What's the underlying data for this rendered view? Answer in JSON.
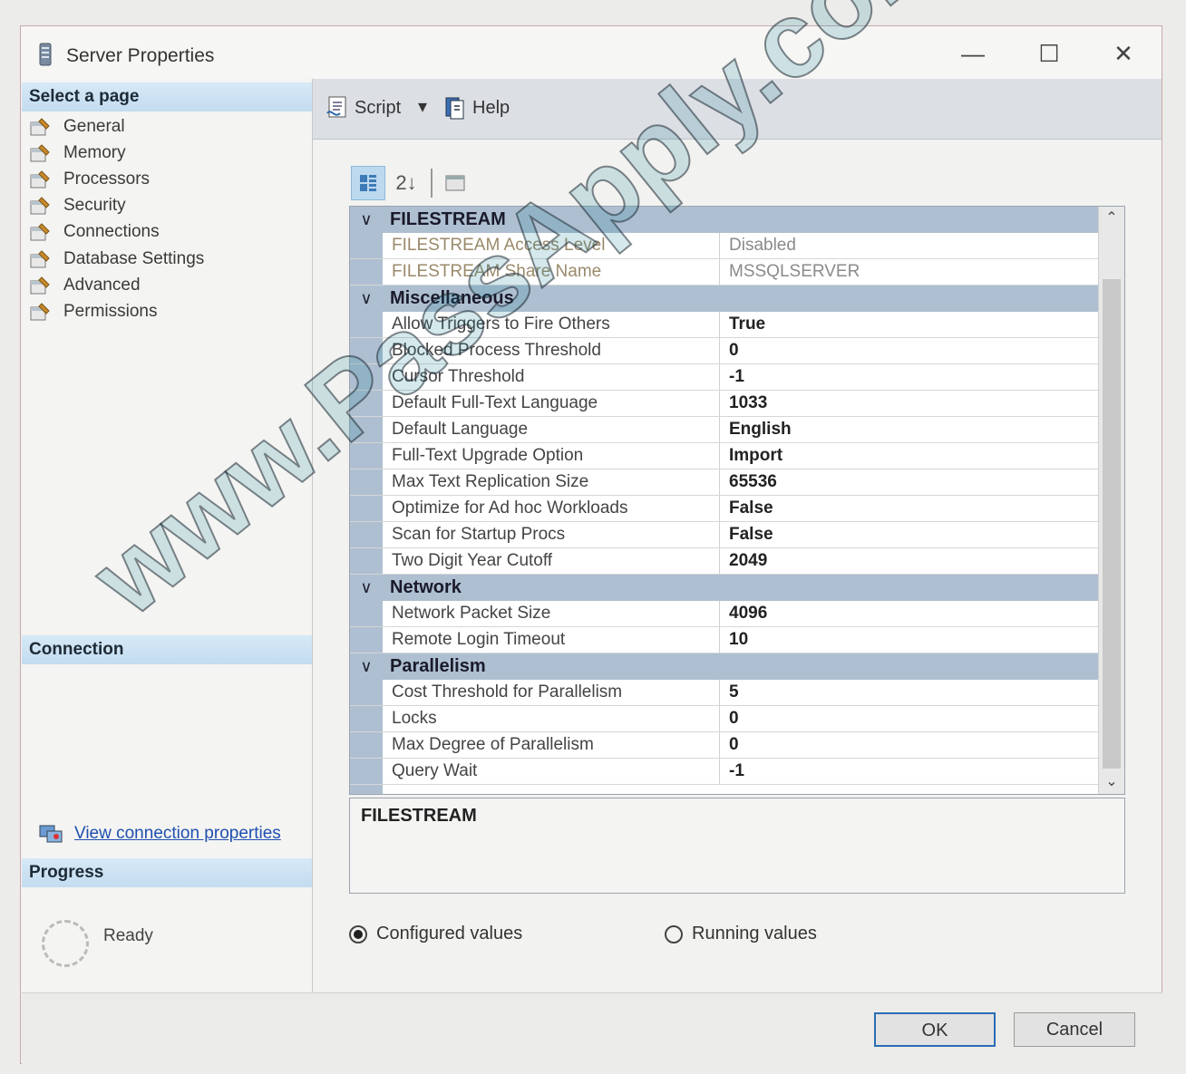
{
  "window": {
    "title": "Server Properties",
    "controls": {
      "minimize": "—",
      "maximize": "☐",
      "close": "✕"
    }
  },
  "left": {
    "select_page_header": "Select a page",
    "pages": [
      {
        "label": "General"
      },
      {
        "label": "Memory"
      },
      {
        "label": "Processors"
      },
      {
        "label": "Security"
      },
      {
        "label": "Connections"
      },
      {
        "label": "Database Settings"
      },
      {
        "label": "Advanced"
      },
      {
        "label": "Permissions"
      }
    ],
    "connection_header": "Connection",
    "view_connection_label": "View connection properties",
    "progress_header": "Progress",
    "progress_status": "Ready"
  },
  "toolbar": {
    "script_label": "Script",
    "script_dropdown": "▾",
    "help_label": "Help"
  },
  "grid_toolbar": {
    "sort_alpha_glyph": "2↓"
  },
  "grid": {
    "categories": [
      {
        "name": "FILESTREAM",
        "chevron": "∨",
        "rows": [
          {
            "name": "FILESTREAM Access Level",
            "value": "Disabled"
          },
          {
            "name": "FILESTREAM Share Name",
            "value": "MSSQLSERVER"
          }
        ]
      },
      {
        "name": "Miscellaneous",
        "chevron": "∨",
        "rows": [
          {
            "name": "Allow Triggers to Fire Others",
            "value": "True"
          },
          {
            "name": "Blocked Process Threshold",
            "value": "0"
          },
          {
            "name": "Cursor Threshold",
            "value": "-1"
          },
          {
            "name": "Default Full-Text Language",
            "value": "1033"
          },
          {
            "name": "Default Language",
            "value": "English"
          },
          {
            "name": "Full-Text Upgrade Option",
            "value": "Import"
          },
          {
            "name": "Max Text Replication Size",
            "value": "65536"
          },
          {
            "name": "Optimize for Ad hoc Workloads",
            "value": "False"
          },
          {
            "name": "Scan for Startup Procs",
            "value": "False"
          },
          {
            "name": "Two Digit Year Cutoff",
            "value": "2049"
          }
        ]
      },
      {
        "name": "Network",
        "chevron": "∨",
        "rows": [
          {
            "name": "Network Packet Size",
            "value": "4096"
          },
          {
            "name": "Remote Login Timeout",
            "value": "10"
          }
        ]
      },
      {
        "name": "Parallelism",
        "chevron": "∨",
        "rows": [
          {
            "name": "Cost Threshold for Parallelism",
            "value": "5"
          },
          {
            "name": "Locks",
            "value": "0"
          },
          {
            "name": "Max Degree of Parallelism",
            "value": "0"
          },
          {
            "name": "Query Wait",
            "value": "-1"
          }
        ]
      }
    ],
    "scroll_up": "⌃",
    "scroll_down": "⌄"
  },
  "description": {
    "title": "FILESTREAM"
  },
  "radios": {
    "configured_label": "Configured values",
    "running_label": "Running values"
  },
  "footer": {
    "ok_label": "OK",
    "cancel_label": "Cancel"
  },
  "watermark": "www.PassApply.com",
  "colors": {
    "section_header": "#c3dcef",
    "grid_category": "#aebfd1",
    "link": "#1f4fb0",
    "ok_border": "#2b6cb5"
  }
}
